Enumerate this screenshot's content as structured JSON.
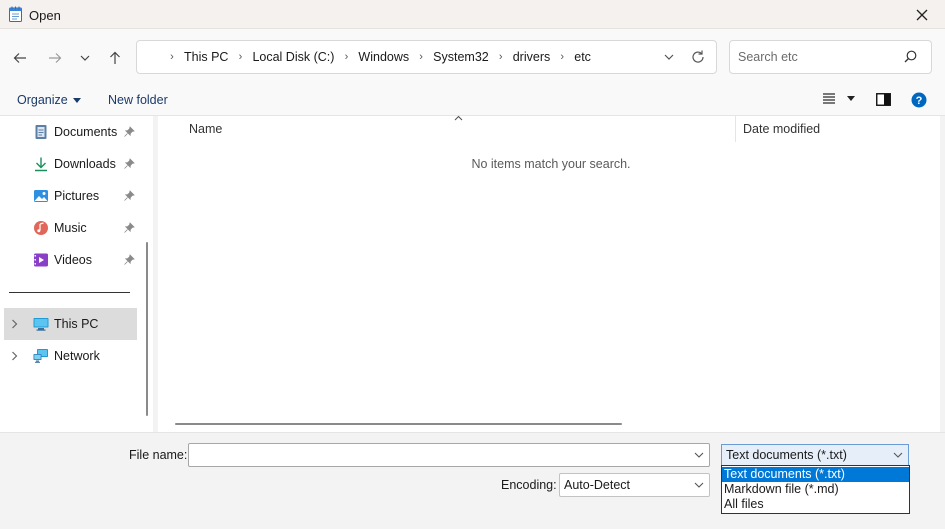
{
  "window": {
    "title": "Open"
  },
  "address": {
    "crumbs": [
      "This PC",
      "Local Disk (C:)",
      "Windows",
      "System32",
      "drivers",
      "etc"
    ]
  },
  "search": {
    "placeholder": "Search etc"
  },
  "toolbar": {
    "organize_label": "Organize",
    "new_folder_label": "New folder"
  },
  "sidebar": {
    "quick_access": [
      {
        "label": "Documents",
        "icon": "document-icon"
      },
      {
        "label": "Downloads",
        "icon": "download-icon"
      },
      {
        "label": "Pictures",
        "icon": "pictures-icon"
      },
      {
        "label": "Music",
        "icon": "music-icon"
      },
      {
        "label": "Videos",
        "icon": "video-icon"
      }
    ],
    "locations": [
      {
        "label": "This PC",
        "icon": "computer-icon",
        "selected": true
      },
      {
        "label": "Network",
        "icon": "network-icon",
        "selected": false
      }
    ]
  },
  "filelist": {
    "columns": {
      "name": "Name",
      "date_modified": "Date modified"
    },
    "empty_message": "No items match your search."
  },
  "bottom": {
    "file_name_label": "File name:",
    "file_name_value": "",
    "encoding_label": "Encoding:",
    "encoding_value": "Auto-Detect",
    "file_type_selected": "Text documents (*.txt)",
    "file_type_options": [
      "Text documents (*.txt)",
      "Markdown file (*.md)",
      "All files"
    ]
  },
  "colors": {
    "accent": "#0078d7",
    "help_icon": "#0067c0"
  }
}
